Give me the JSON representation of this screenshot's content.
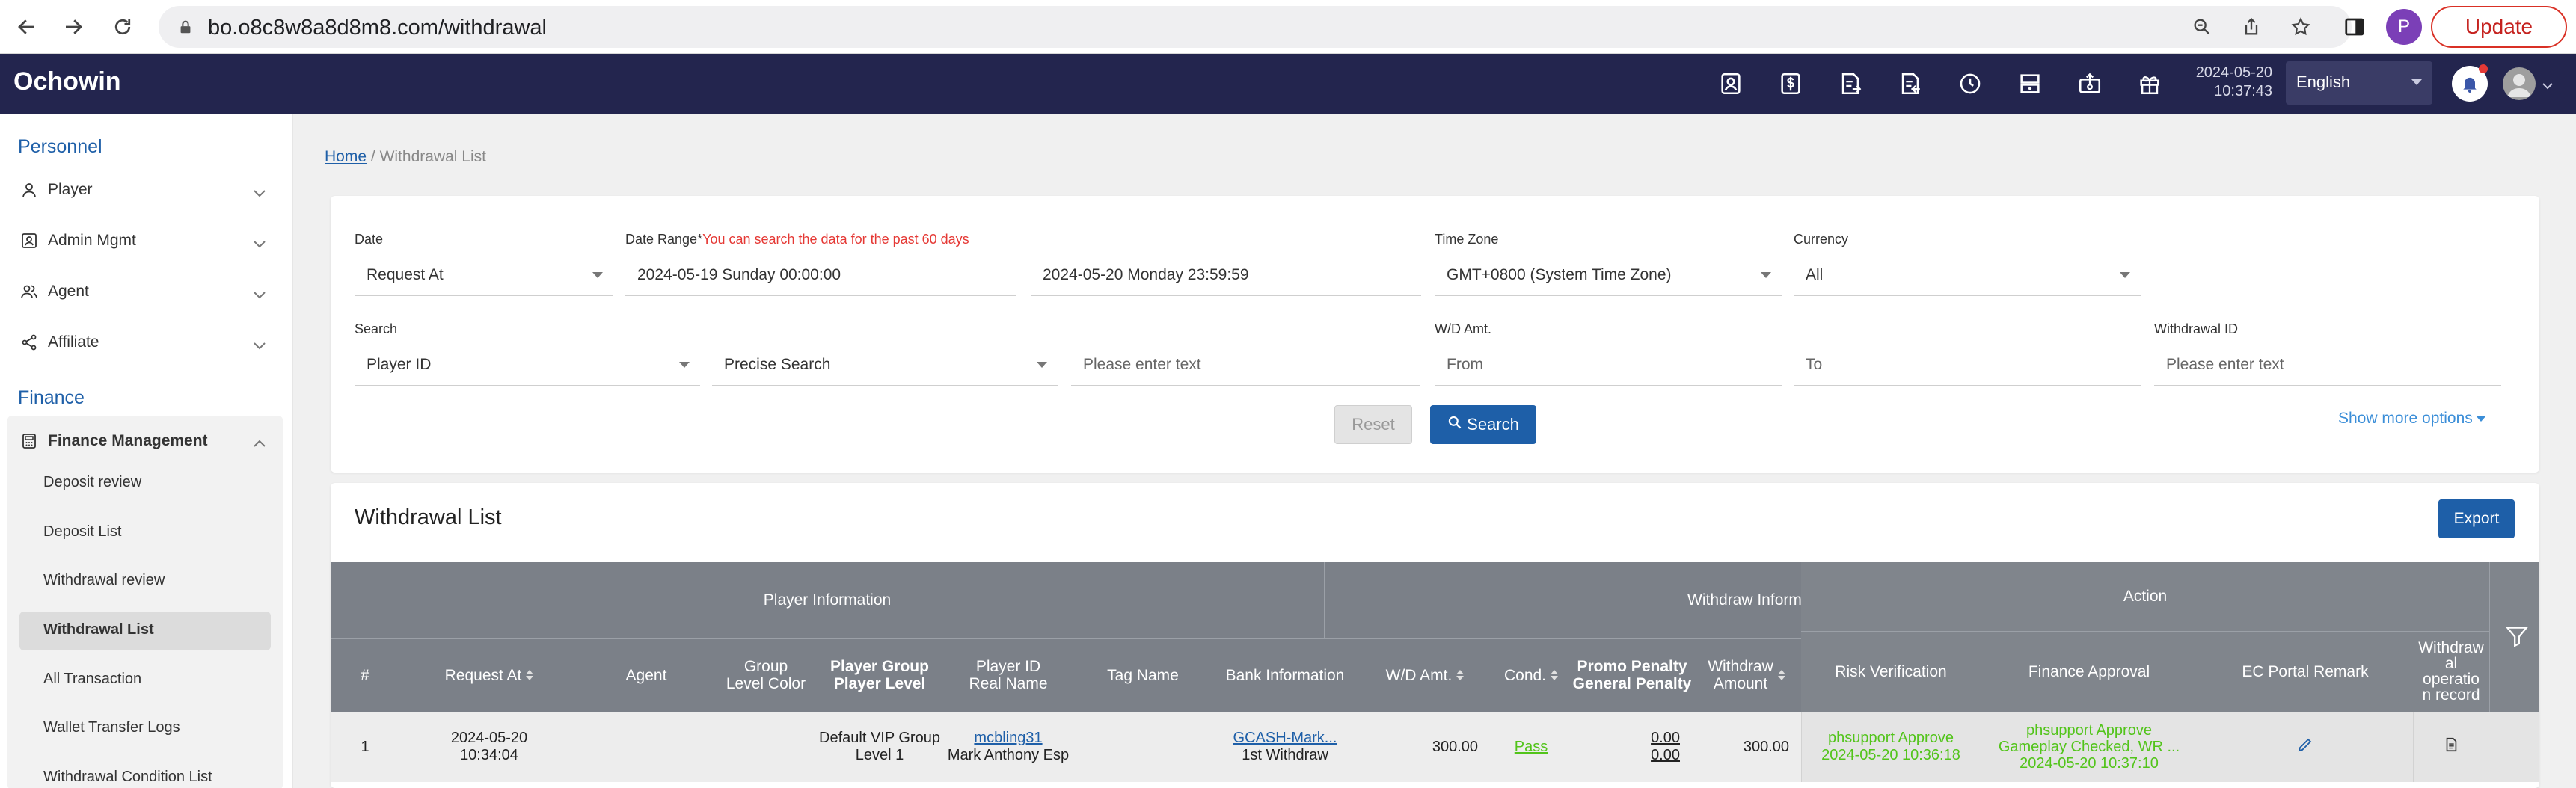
{
  "browser": {
    "url": "bo.o8c8w8a8d8m8.com/withdrawal",
    "profile_initial": "P",
    "update_label": "Update"
  },
  "header": {
    "logo": "Ochowin",
    "date": "2024-05-20",
    "time": "10:37:43",
    "language": "English"
  },
  "sidebar": {
    "personnel_title": "Personnel",
    "items": [
      {
        "label": "Player",
        "icon": "user-icon"
      },
      {
        "label": "Admin Mgmt",
        "icon": "admin-icon"
      },
      {
        "label": "Agent",
        "icon": "agent-icon"
      },
      {
        "label": "Affiliate",
        "icon": "share-icon"
      }
    ],
    "finance_title": "Finance",
    "finance_group": "Finance Management",
    "finance_subs": [
      "Deposit review",
      "Deposit List",
      "Withdrawal review",
      "Withdrawal List",
      "All Transaction",
      "Wallet Transfer Logs",
      "Withdrawal Condition List"
    ],
    "active_sub": "Withdrawal List"
  },
  "breadcrumb": {
    "home": "Home",
    "separator": "/",
    "current": "Withdrawal List"
  },
  "filters": {
    "date_label": "Date",
    "date_value": "Request At",
    "range_label": "Date Range",
    "range_star": "*",
    "range_note": "You can search the data for the past 60 days",
    "range_start": "2024-05-19 Sunday 00:00:00",
    "range_end": "2024-05-20 Monday 23:59:59",
    "tz_label": "Time Zone",
    "tz_value": "GMT+0800 (System Time Zone)",
    "currency_label": "Currency",
    "currency_value": "All",
    "search_label": "Search",
    "search_by": "Player ID",
    "search_mode": "Precise Search",
    "search_placeholder": "Please enter text",
    "amt_label": "W/D Amt.",
    "amt_from": "From",
    "amt_to": "To",
    "wid_label": "Withdrawal ID",
    "wid_placeholder": "Please enter text",
    "reset": "Reset",
    "search": "Search",
    "more": "Show more options"
  },
  "list": {
    "title": "Withdrawal List",
    "export": "Export",
    "groups": {
      "player_info": "Player Information",
      "withdraw_info": "Withdraw Information",
      "action": "Action"
    },
    "columns": {
      "idx": "#",
      "request_at": "Request At",
      "agent": "Agent",
      "group_color_1": "Group",
      "group_color_2": "Level Color",
      "player_group": "Player Group",
      "player_level": "Player Level",
      "player_id": "Player ID",
      "real_name": "Real Name",
      "tag_name": "Tag Name",
      "bank_info": "Bank Information",
      "wd_amt": "W/D Amt.",
      "cond": "Cond.",
      "promo_penalty": "Promo Penalty",
      "general_penalty": "General Penalty",
      "withdraw_amount_1": "Withdraw",
      "withdraw_amount_2": "Amount",
      "risk_verification": "Risk Verification",
      "finance_approval": "Finance Approval",
      "ec_portal_remark": "EC Portal Remark",
      "wd_record_1": "Withdraw",
      "wd_record_2": "al",
      "wd_record_3": "operatio",
      "wd_record_4": "n record"
    },
    "rows": [
      {
        "idx": "1",
        "request_date": "2024-05-20",
        "request_time": "10:34:04",
        "agent": "",
        "player_group": "Default VIP Group",
        "player_level": "Level 1",
        "player_id": "mcbling31",
        "real_name": "Mark Anthony Esp",
        "tag_name": "",
        "bank": "GCASH-Mark...",
        "bank_note": "1st Withdraw",
        "wd_amt": "300.00",
        "cond": "Pass",
        "promo_penalty": "0.00",
        "general_penalty": "0.00",
        "withdraw_amount": "300.00",
        "risk_status": "phsupport Approve",
        "risk_time": "2024-05-20 10:36:18",
        "finance_status": "phsupport Approve",
        "finance_note": "Gameplay Checked, WR ...",
        "finance_time": "2024-05-20 10:37:10"
      }
    ]
  }
}
